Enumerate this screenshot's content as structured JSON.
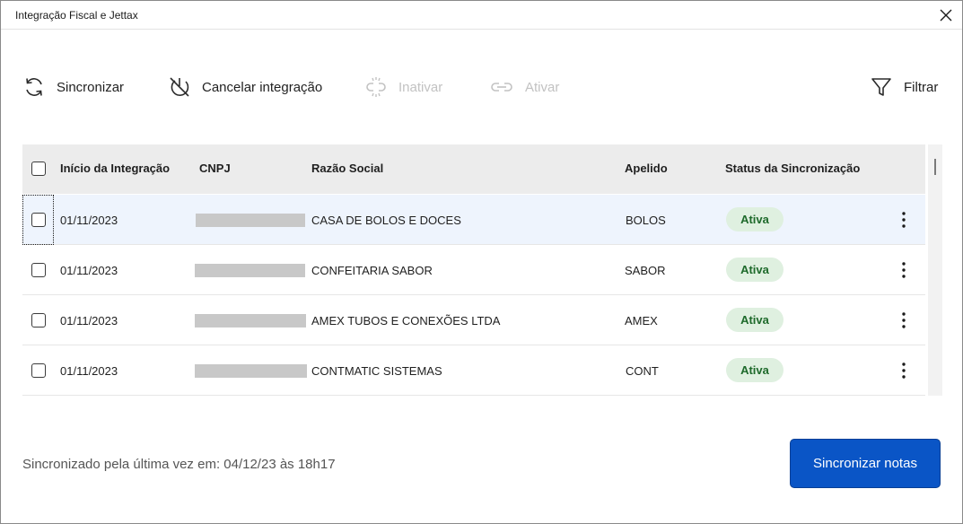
{
  "window": {
    "title": "Integração Fiscal e Jettax",
    "close_icon": "close-icon"
  },
  "toolbar": {
    "sync_label": "Sincronizar",
    "cancel_label": "Cancelar integração",
    "inactivate_label": "Inativar",
    "activate_label": "Ativar",
    "filter_label": "Filtrar"
  },
  "table": {
    "columns": [
      "Início da Integração",
      "CNPJ",
      "Razão Social",
      "Apelido",
      "Status da Sincronização"
    ],
    "rows": [
      {
        "date": "01/11/2023",
        "razao": "CASA DE BOLOS E DOCES",
        "apelido": "BOLOS",
        "status": "Ativa"
      },
      {
        "date": "01/11/2023",
        "razao": "CONFEITARIA SABOR",
        "apelido": "SABOR",
        "status": "Ativa"
      },
      {
        "date": "01/11/2023",
        "razao": "AMEX TUBOS E CONEXÕES LTDA",
        "apelido": "AMEX",
        "status": "Ativa"
      },
      {
        "date": "01/11/2023",
        "razao": "CONTMATIC SISTEMAS",
        "apelido": "CONT",
        "status": "Ativa"
      }
    ]
  },
  "footer": {
    "last_sync": "Sincronizado pela última vez em: 04/12/23 às 18h17",
    "sync_notes_label": "Sincronizar notas"
  },
  "colors": {
    "primary": "#0a55c6",
    "badge_bg": "#dff0e0",
    "badge_text": "#1e6a2b",
    "disabled": "#c2c2c2"
  }
}
